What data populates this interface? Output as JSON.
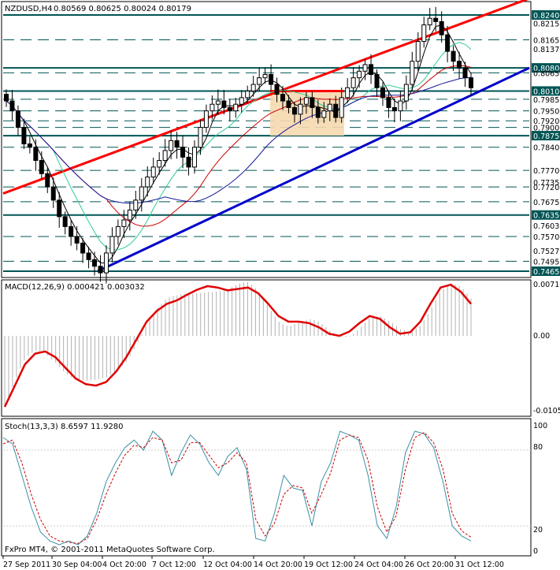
{
  "header": {
    "symbol_tf": "NZDUSD,H4",
    "ohlc": "0.80569 0.80625 0.80024 0.80179"
  },
  "macd_header": "MACD(12,26,9) 0.000421 0.003032",
  "stoch_header": "Stoch(13,3,3) 8.6597 11.9280",
  "copyright": "FxPro MT4, © 2001-2011 MetaQuotes Software Corp.",
  "chart_data": [
    {
      "type": "candlestick",
      "title": "NZDUSD,H4",
      "price_labels": [
        "0.82400",
        "0.82150",
        "0.81651",
        "0.81370",
        "0.80800",
        "0.80650",
        "0.80100",
        "0.79850",
        "0.79500",
        "0.79200",
        "0.79000",
        "0.78750",
        "0.78400",
        "0.77700",
        "0.77350",
        "0.77200",
        "0.76750",
        "0.76350",
        "0.76030",
        "0.75700",
        "0.75270",
        "0.74950",
        "0.74650"
      ],
      "highlight_labels": [
        "0.82400",
        "0.80800",
        "0.80100",
        "0.78750",
        "0.76350",
        "0.74650"
      ],
      "dashed_levels": [
        0.8165,
        0.8065,
        0.7985,
        0.795,
        0.792,
        0.79,
        0.784,
        0.777,
        0.772,
        0.7675,
        0.757,
        0.7495
      ],
      "solid_levels": [
        0.824,
        0.808,
        0.801,
        0.7875,
        0.7635,
        0.7465
      ],
      "x_labels": [
        "27 Sep 2011",
        "30 Sep 04:00",
        "4 Oct 20:00",
        "7 Oct 12:00",
        "12 Oct 04:00",
        "14 Oct 20:00",
        "19 Oct 12:00",
        "24 Oct 04:00",
        "26 Oct 20:00",
        "31 Oct 12:00"
      ],
      "close_path": [
        0.798,
        0.795,
        0.79,
        0.785,
        0.784,
        0.78,
        0.776,
        0.772,
        0.768,
        0.763,
        0.76,
        0.757,
        0.755,
        0.752,
        0.75,
        0.748,
        0.746,
        0.752,
        0.757,
        0.76,
        0.762,
        0.765,
        0.768,
        0.772,
        0.775,
        0.778,
        0.78,
        0.783,
        0.786,
        0.784,
        0.781,
        0.778,
        0.784,
        0.79,
        0.795,
        0.797,
        0.798,
        0.796,
        0.795,
        0.797,
        0.799,
        0.801,
        0.803,
        0.805,
        0.806,
        0.803,
        0.8,
        0.798,
        0.796,
        0.794,
        0.797,
        0.799,
        0.796,
        0.793,
        0.795,
        0.797,
        0.793,
        0.799,
        0.802,
        0.805,
        0.807,
        0.809,
        0.806,
        0.802,
        0.799,
        0.796,
        0.795,
        0.798,
        0.803,
        0.81,
        0.816,
        0.821,
        0.823,
        0.822,
        0.818,
        0.813,
        0.81,
        0.808,
        0.805,
        0.802
      ],
      "trendlines": [
        {
          "color": "#ff0000",
          "from": [
            0,
            0.77
          ],
          "to": [
            1,
            0.829
          ]
        },
        {
          "color": "#0000cc",
          "from": [
            0.18,
            0.7465
          ],
          "to": [
            1,
            0.808
          ]
        }
      ],
      "resistance_box": {
        "from": 0.7875,
        "to": 0.801
      }
    },
    {
      "type": "line",
      "title": "MACD(12,26,9)",
      "y_labels": [
        "0.00710",
        "0.00",
        "-0.01052"
      ],
      "signal": [
        -0.01,
        -0.007,
        -0.004,
        -0.0025,
        -0.0022,
        -0.003,
        -0.0045,
        -0.006,
        -0.0068,
        -0.007,
        -0.0065,
        -0.005,
        -0.003,
        -0.0005,
        0.002,
        0.0035,
        0.0045,
        0.005,
        0.0058,
        0.0065,
        0.007,
        0.0068,
        0.0064,
        0.0066,
        0.0068,
        0.006,
        0.0045,
        0.0028,
        0.002,
        0.002,
        0.0018,
        0.0012,
        0.0003,
        0.0,
        0.0006,
        0.0018,
        0.0028,
        0.0024,
        0.0012,
        0.0003,
        0.0005,
        0.002,
        0.0045,
        0.0068,
        0.0072,
        0.0062,
        0.0045
      ]
    },
    {
      "type": "line",
      "title": "Stoch(13,3,3)",
      "y_labels": [
        "100",
        "80",
        "20",
        "0"
      ],
      "main": [
        90,
        85,
        60,
        35,
        15,
        8,
        5,
        8,
        5,
        12,
        30,
        55,
        70,
        82,
        88,
        80,
        95,
        88,
        60,
        78,
        92,
        85,
        70,
        60,
        75,
        82,
        65,
        10,
        8,
        30,
        60,
        50,
        48,
        20,
        55,
        70,
        95,
        92,
        88,
        60,
        20,
        10,
        35,
        78,
        95,
        93,
        82,
        55,
        20,
        12,
        8
      ],
      "signal": [
        85,
        88,
        70,
        45,
        25,
        12,
        8,
        7,
        6,
        10,
        25,
        45,
        62,
        76,
        84,
        82,
        90,
        88,
        70,
        72,
        86,
        86,
        76,
        66,
        70,
        78,
        70,
        25,
        12,
        22,
        45,
        52,
        50,
        30,
        45,
        62,
        88,
        92,
        90,
        72,
        35,
        15,
        28,
        65,
        90,
        94,
        86,
        65,
        30,
        16,
        11
      ]
    }
  ]
}
